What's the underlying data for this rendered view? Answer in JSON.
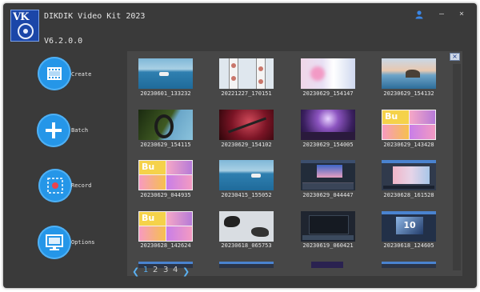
{
  "app": {
    "title": "DIKDIK Video Kit 2023",
    "version": "V6.2.0.0",
    "logo_text": "VK",
    "accent": "#2596e8"
  },
  "titlebar": {
    "user_icon": "user-icon",
    "minimize_glyph": "–",
    "close_glyph": "×"
  },
  "sidebar": {
    "items": [
      {
        "label": "Create",
        "icon": "film-icon"
      },
      {
        "label": "Batch",
        "icon": "plus-icon"
      },
      {
        "label": "Record",
        "icon": "record-icon"
      },
      {
        "label": "Options",
        "icon": "monitor-icon"
      }
    ]
  },
  "gallery": {
    "close_glyph": "×",
    "items": [
      {
        "caption": "20230601_133232",
        "kind": "sea"
      },
      {
        "caption": "20221227_170151",
        "kind": "phones"
      },
      {
        "caption": "20230629_154147",
        "kind": "blurpink"
      },
      {
        "caption": "20230629_154132",
        "kind": "sunset"
      },
      {
        "caption": "20230629_154115",
        "kind": "forest"
      },
      {
        "caption": "20230629_154102",
        "kind": "redtunnel"
      },
      {
        "caption": "20230629_154005",
        "kind": "concert"
      },
      {
        "caption": "20230629_143428",
        "kind": "collage"
      },
      {
        "caption": "20230629_044935",
        "kind": "collage"
      },
      {
        "caption": "20230415_155052",
        "kind": "sea"
      },
      {
        "caption": "20230629_044447",
        "kind": "editor"
      },
      {
        "caption": "20230628_161528",
        "kind": "ui"
      },
      {
        "caption": "20230628_142624",
        "kind": "collage"
      },
      {
        "caption": "20230618_065753",
        "kind": "splash"
      },
      {
        "caption": "20230619_060421",
        "kind": "darkui"
      },
      {
        "caption": "20230618_124605",
        "kind": "ten"
      }
    ],
    "ten_label": "10"
  },
  "pagination": {
    "prev_glyph": "❮",
    "next_glyph": "❯",
    "pages": [
      "1",
      "2",
      "3",
      "4"
    ],
    "current": "1"
  }
}
